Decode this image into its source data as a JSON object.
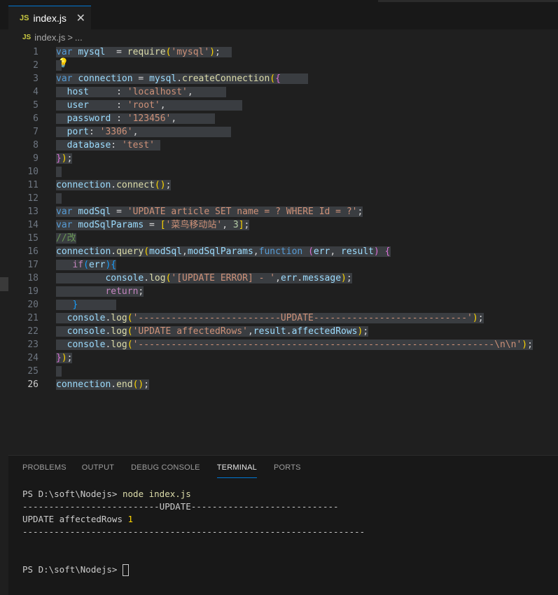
{
  "tab": {
    "icon": "JS",
    "label": "index.js",
    "close": "✕"
  },
  "breadcrumb": {
    "icon": "JS",
    "file": "index.js",
    "separator": ">",
    "rest": "..."
  },
  "editor": {
    "active_line": "26",
    "lines": [
      {
        "n": "1"
      },
      {
        "n": "2"
      },
      {
        "n": "3"
      },
      {
        "n": "4"
      },
      {
        "n": "5"
      },
      {
        "n": "6"
      },
      {
        "n": "7"
      },
      {
        "n": "8"
      },
      {
        "n": "9"
      },
      {
        "n": "10"
      },
      {
        "n": "11"
      },
      {
        "n": "12"
      },
      {
        "n": "13"
      },
      {
        "n": "14"
      },
      {
        "n": "15"
      },
      {
        "n": "16"
      },
      {
        "n": "17"
      },
      {
        "n": "18"
      },
      {
        "n": "19"
      },
      {
        "n": "20"
      },
      {
        "n": "21"
      },
      {
        "n": "22"
      },
      {
        "n": "23"
      },
      {
        "n": "24"
      },
      {
        "n": "25"
      },
      {
        "n": "26"
      }
    ],
    "code": [
      [
        [
          "kw",
          "var"
        ],
        [
          "op",
          " "
        ],
        [
          "id",
          "mysql"
        ],
        [
          "op",
          "  = "
        ],
        [
          "fn",
          "require"
        ],
        [
          "p1",
          "("
        ],
        [
          "str",
          "'mysql'"
        ],
        [
          "p1",
          ")"
        ],
        [
          "op",
          ";  "
        ]
      ],
      [
        [
          "op",
          " "
        ]
      ],
      [
        [
          "kw",
          "var"
        ],
        [
          "op",
          " "
        ],
        [
          "id",
          "connection"
        ],
        [
          "op",
          " = "
        ],
        [
          "id",
          "mysql"
        ],
        [
          "op",
          "."
        ],
        [
          "fn",
          "createConnection"
        ],
        [
          "p1",
          "("
        ],
        [
          "p2",
          "{"
        ],
        [
          "op",
          "     "
        ]
      ],
      [
        [
          "op",
          "  "
        ],
        [
          "id",
          "host"
        ],
        [
          "op",
          "     : "
        ],
        [
          "str",
          "'localhost'"
        ],
        [
          "op",
          ",      "
        ]
      ],
      [
        [
          "op",
          "  "
        ],
        [
          "id",
          "user"
        ],
        [
          "op",
          "     : "
        ],
        [
          "str",
          "'root'"
        ],
        [
          "op",
          ",              "
        ]
      ],
      [
        [
          "op",
          "  "
        ],
        [
          "id",
          "password"
        ],
        [
          "op",
          " : "
        ],
        [
          "str",
          "'123456'"
        ],
        [
          "op",
          ",       "
        ]
      ],
      [
        [
          "op",
          "  "
        ],
        [
          "id",
          "port"
        ],
        [
          "op",
          ": "
        ],
        [
          "str",
          "'3306'"
        ],
        [
          "op",
          ",                 "
        ]
      ],
      [
        [
          "op",
          "  "
        ],
        [
          "id",
          "database"
        ],
        [
          "op",
          ": "
        ],
        [
          "str",
          "'test'"
        ],
        [
          "op",
          " "
        ]
      ],
      [
        [
          "p2",
          "}"
        ],
        [
          "p1",
          ")"
        ],
        [
          "op",
          ";"
        ]
      ],
      [
        [
          "op",
          " "
        ]
      ],
      [
        [
          "id",
          "connection"
        ],
        [
          "op",
          "."
        ],
        [
          "fn",
          "connect"
        ],
        [
          "p1",
          "()"
        ],
        [
          "op",
          ";"
        ]
      ],
      [
        [
          "op",
          " "
        ]
      ],
      [
        [
          "kw",
          "var"
        ],
        [
          "op",
          " "
        ],
        [
          "id",
          "modSql"
        ],
        [
          "op",
          " = "
        ],
        [
          "str",
          "'UPDATE article SET name = ? WHERE Id = ?'"
        ],
        [
          "op",
          ";"
        ]
      ],
      [
        [
          "kw",
          "var"
        ],
        [
          "op",
          " "
        ],
        [
          "id",
          "modSqlParams"
        ],
        [
          "op",
          " = "
        ],
        [
          "p1",
          "["
        ],
        [
          "str",
          "'菜鸟移动站'"
        ],
        [
          "op",
          ", "
        ],
        [
          "num",
          "3"
        ],
        [
          "p1",
          "]"
        ],
        [
          "op",
          ";"
        ]
      ],
      [
        [
          "cmt",
          "//改"
        ]
      ],
      [
        [
          "id",
          "connection"
        ],
        [
          "op",
          "."
        ],
        [
          "fn",
          "query"
        ],
        [
          "p1",
          "("
        ],
        [
          "id",
          "modSql"
        ],
        [
          "op",
          ","
        ],
        [
          "id",
          "modSqlParams"
        ],
        [
          "op",
          ","
        ],
        [
          "kw",
          "function"
        ],
        [
          "op",
          " "
        ],
        [
          "p2",
          "("
        ],
        [
          "id",
          "err"
        ],
        [
          "op",
          ", "
        ],
        [
          "id",
          "result"
        ],
        [
          "p2",
          ")"
        ],
        [
          "op",
          " "
        ],
        [
          "p2",
          "{"
        ]
      ],
      [
        [
          "op",
          "   "
        ],
        [
          "ctl",
          "if"
        ],
        [
          "p3",
          "("
        ],
        [
          "id",
          "err"
        ],
        [
          "p3",
          ")"
        ],
        [
          "p3",
          "{"
        ]
      ],
      [
        [
          "op",
          "         "
        ],
        [
          "id",
          "console"
        ],
        [
          "op",
          "."
        ],
        [
          "fn",
          "log"
        ],
        [
          "p1",
          "("
        ],
        [
          "str",
          "'[UPDATE ERROR] - '"
        ],
        [
          "op",
          ","
        ],
        [
          "id",
          "err"
        ],
        [
          "op",
          "."
        ],
        [
          "id",
          "message"
        ],
        [
          "p1",
          ")"
        ],
        [
          "op",
          ";"
        ]
      ],
      [
        [
          "op",
          "         "
        ],
        [
          "ctl",
          "return"
        ],
        [
          "op",
          ";"
        ]
      ],
      [
        [
          "op",
          "   "
        ],
        [
          "p3",
          "}"
        ],
        [
          "op",
          "       "
        ]
      ],
      [
        [
          "op",
          "  "
        ],
        [
          "id",
          "console"
        ],
        [
          "op",
          "."
        ],
        [
          "fn",
          "log"
        ],
        [
          "p1",
          "("
        ],
        [
          "str",
          "'--------------------------UPDATE----------------------------'"
        ],
        [
          "p1",
          ")"
        ],
        [
          "op",
          ";"
        ]
      ],
      [
        [
          "op",
          "  "
        ],
        [
          "id",
          "console"
        ],
        [
          "op",
          "."
        ],
        [
          "fn",
          "log"
        ],
        [
          "p1",
          "("
        ],
        [
          "str",
          "'UPDATE affectedRows'"
        ],
        [
          "op",
          ","
        ],
        [
          "id",
          "result"
        ],
        [
          "op",
          "."
        ],
        [
          "id",
          "affectedRows"
        ],
        [
          "p1",
          ")"
        ],
        [
          "op",
          ";"
        ]
      ],
      [
        [
          "op",
          "  "
        ],
        [
          "id",
          "console"
        ],
        [
          "op",
          "."
        ],
        [
          "fn",
          "log"
        ],
        [
          "p1",
          "("
        ],
        [
          "str",
          "'-----------------------------------------------------------------\\n\\n'"
        ],
        [
          "p1",
          ")"
        ],
        [
          "op",
          ";"
        ]
      ],
      [
        [
          "p2",
          "}"
        ],
        [
          "p1",
          ")"
        ],
        [
          "op",
          ";"
        ]
      ],
      [
        [
          "op",
          " "
        ]
      ],
      [
        [
          "id",
          "connection"
        ],
        [
          "op",
          "."
        ],
        [
          "fn",
          "end"
        ],
        [
          "p1",
          "()"
        ],
        [
          "op",
          ";"
        ]
      ]
    ]
  },
  "panel": {
    "tabs": [
      "PROBLEMS",
      "OUTPUT",
      "DEBUG CONSOLE",
      "TERMINAL",
      "PORTS"
    ],
    "active_tab": "TERMINAL",
    "terminal": {
      "prompt": "PS D:\\soft\\Nodejs> ",
      "command": "node index.js",
      "out_update": "--------------------------UPDATE----------------------------",
      "out_rows_label": "UPDATE affectedRows ",
      "out_rows_value": "1",
      "out_sep": "-----------------------------------------------------------------",
      "prompt2": "PS D:\\soft\\Nodejs> "
    }
  },
  "colors": {
    "accent": "#0078d4",
    "editor_bg": "#1f1f1f",
    "selection": "#3a3d41"
  }
}
